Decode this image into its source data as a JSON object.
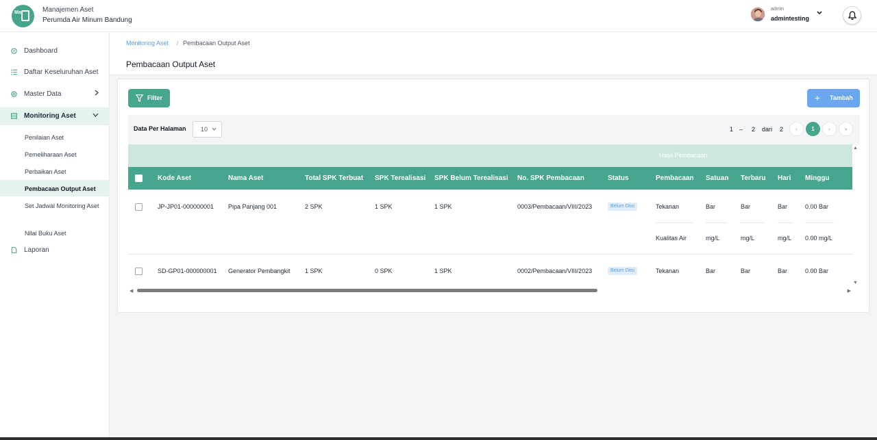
{
  "app": {
    "logo_text": "Ma",
    "title": "Manajemen Aset",
    "subtitle": "Perumda Air Minum Bandung"
  },
  "user": {
    "role": "admin",
    "name": "admintesting"
  },
  "sidebar": {
    "items": [
      {
        "label": "Dashboard",
        "icon": "dashboard-icon"
      },
      {
        "label": "Daftar Keseluruhan Aset",
        "icon": "list-icon"
      },
      {
        "label": "Master Data",
        "icon": "database-icon"
      },
      {
        "label": "Monitoring Aset",
        "icon": "monitoring-icon"
      },
      {
        "label": "Laporan",
        "icon": "report-icon"
      }
    ],
    "subitems": [
      {
        "label": "Penilaian Aset"
      },
      {
        "label": "Pemeliharaan Aset"
      },
      {
        "label": "Perbaikan Aset"
      },
      {
        "label": "Pembacaan Output Aset"
      },
      {
        "label": "Set Jadwal Monitoring Aset"
      },
      {
        "label": "Nilai Buku Aset"
      }
    ]
  },
  "breadcrumb": {
    "parent": "Monitoring Aset",
    "separator": "/",
    "current": "Pembacaan Output Aset"
  },
  "page": {
    "title": "Pembacaan Output Aset"
  },
  "toolbar": {
    "filter_label": "Filter",
    "add_label": "Tambah",
    "add_icon": "+"
  },
  "pagination": {
    "per_page_label": "Data Per Halaman",
    "per_page_value": "10",
    "range_start": "1",
    "range_dash": "–",
    "range_end": "2",
    "of_label": "dari",
    "total": "2",
    "first": "‹",
    "current_page": "1",
    "next": "›",
    "last": "»"
  },
  "table": {
    "group_header": "Hasil Pembacaan",
    "columns": [
      "Kode Aset",
      "Nama Aset",
      "Total SPK Terbuat",
      "SPK Terealisasi",
      "SPK Belum Terealisasi",
      "No. SPK Pembacaan",
      "Status",
      "Pembacaan",
      "Satuan",
      "Terbaru",
      "Hari",
      "Minggu"
    ],
    "rows": [
      {
        "kode": "JP-JP01-000000001",
        "nama": "Pipa Panjang 001",
        "total_spk": "2 SPK",
        "terealisasi": "1 SPK",
        "belum": "1 SPK",
        "no_spk": "0003/Pembacaan/VIII/2023",
        "status": "Belum Diisi",
        "readings": [
          {
            "pembacaan": "Tekanan",
            "satuan": "Bar",
            "terbaru": "Bar",
            "hari": "Bar",
            "minggu": "0.00 Bar"
          },
          {
            "pembacaan": "Kualitas Air",
            "satuan": "mg/L",
            "terbaru": "mg/L",
            "hari": "mg/L",
            "minggu": "0.00 mg/L"
          }
        ]
      },
      {
        "kode": "SD-GP01-000000001",
        "nama": "Generator Pembangkit",
        "total_spk": "1 SPK",
        "terealisasi": "0 SPK",
        "belum": "1 SPK",
        "no_spk": "0002/Pembacaan/VIII/2023",
        "status": "Belum Diisi",
        "readings": [
          {
            "pembacaan": "Tekanan",
            "satuan": "Bar",
            "terbaru": "Bar",
            "hari": "Bar",
            "minggu": "0.00 Bar"
          }
        ]
      }
    ]
  },
  "colors": {
    "primary": "#46a58d",
    "accent_blue": "#6aa7ef",
    "group_header_bg": "#cde6de",
    "active_nav_bg": "#e6f2ee"
  }
}
